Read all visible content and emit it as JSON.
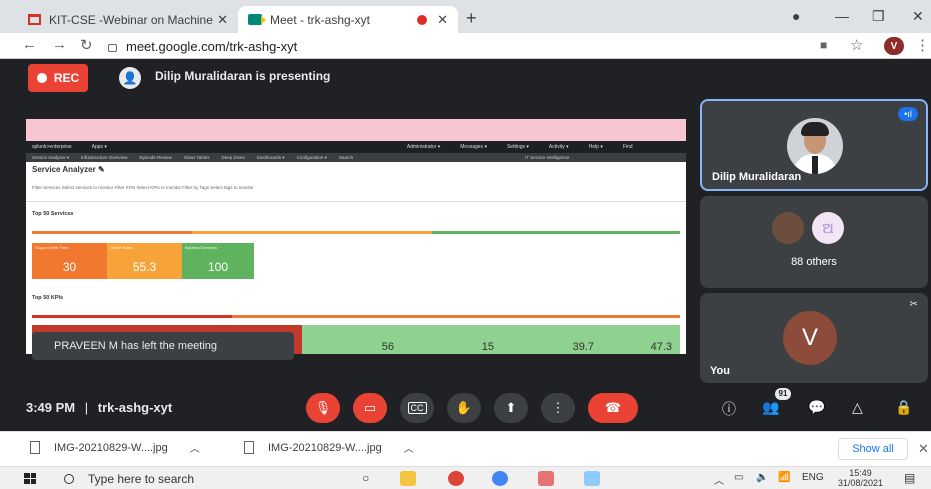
{
  "browser": {
    "tabs": [
      {
        "title": "KIT-CSE -Webinar on Machine Le",
        "icon": "gmail-icon"
      },
      {
        "title": "Meet - trk-ashg-xyt",
        "icon": "meet-icon"
      }
    ],
    "new_tab": "+",
    "url": "meet.google.com/trk-ashg-xyt",
    "profile_initial": "V"
  },
  "meet": {
    "rec_label": "REC",
    "presenting_text": "Dilip Muralidaran is presenting",
    "time": "3:49 PM",
    "separator": "|",
    "meeting_code": "trk-ashg-xyt",
    "toast": "PRAVEEN M has left the meeting",
    "participants": [
      {
        "name": "Dilip Muralidaran"
      },
      {
        "name": "88 others"
      },
      {
        "name": "You",
        "initial": "V"
      }
    ],
    "people_count": "91",
    "others_avatar_text": "ଅ"
  },
  "shared_screen": {
    "nav": [
      "splunk>enterprise",
      "Apps ▾",
      "Administrator ▾",
      "Messages ▾",
      "Settings ▾",
      "Activity ▾",
      "Help ▾",
      "Find"
    ],
    "nav2": [
      "Service Analyzer ▾",
      "Infrastructure Overview",
      "Episode Review",
      "Glass Tables",
      "Deep Dives",
      "Dashboards ▾",
      "Configuration ▾",
      "Search",
      "IT Service Intelligence"
    ],
    "title": "Service Analyzer ✎",
    "filter_text": "Filter Services    Select services to monitor    Filter KPIs    Select KPIs to monitor    Filter by Tags    Select tags to monitor",
    "services_heading": "Top 50 Services",
    "kpis_heading": "Top 50 KPIs",
    "service_tiles": [
      {
        "label": "Support Web Farm",
        "value": "30",
        "color": "#f0782f"
      },
      {
        "label": "Online Sales",
        "value": "55.3",
        "color": "#f7a33a"
      },
      {
        "label": "Backend Services",
        "value": "100",
        "color": "#5fb35f"
      }
    ],
    "kpi_tiles": [
      {
        "value": "56"
      },
      {
        "value": "15"
      },
      {
        "value": "39.7"
      },
      {
        "value": "47.3"
      }
    ]
  },
  "downloads": [
    {
      "name": "IMG-20210829-W....jpg"
    },
    {
      "name": "IMG-20210829-W....jpg"
    }
  ],
  "downloads_show_all": "Show all",
  "taskbar": {
    "search_placeholder": "Type here to search",
    "lang": "ENG",
    "time": "15:49",
    "date": "31/08/2021"
  }
}
